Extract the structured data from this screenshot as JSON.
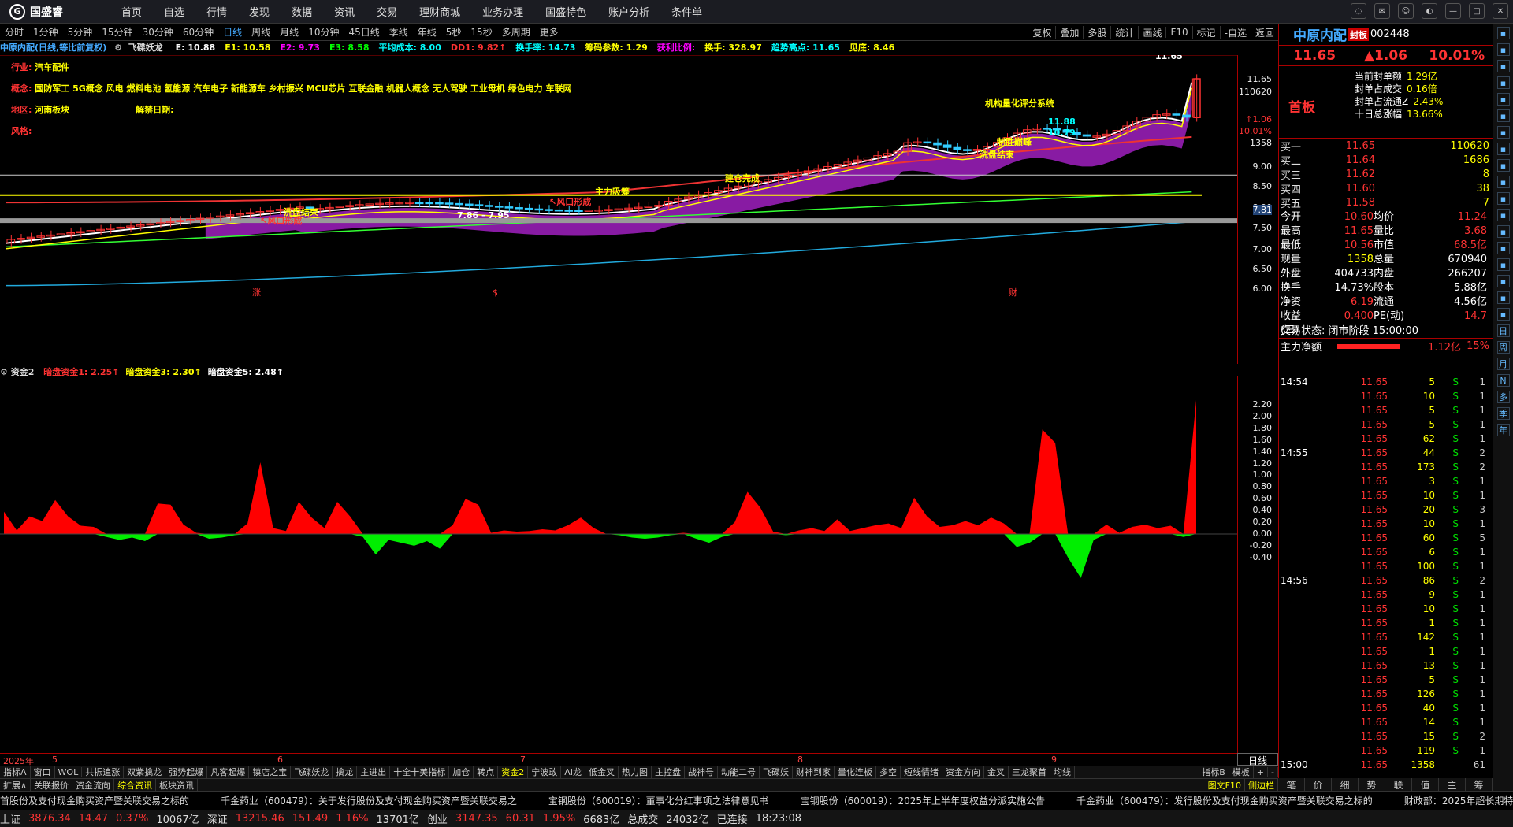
{
  "app": {
    "logo_text": "国盛睿"
  },
  "menu": [
    "首页",
    "自选",
    "行情",
    "发现",
    "数据",
    "资讯",
    "交易",
    "理财商城",
    "业务办理",
    "国盛特色",
    "账户分析",
    "条件单"
  ],
  "periods": [
    "分时",
    "1分钟",
    "5分钟",
    "15分钟",
    "30分钟",
    "60分钟",
    "日线",
    "周线",
    "月线",
    "10分钟",
    "45日线",
    "季线",
    "年线",
    "5秒",
    "15秒",
    "多周期",
    "更多"
  ],
  "period_right": [
    "复权",
    "叠加",
    "多股",
    "统计",
    "画线",
    "F10",
    "标记",
    "-自选",
    "返回"
  ],
  "legend": {
    "title": "中原内配(日线,等比前复权)",
    "indicator": "飞碟妖龙",
    "items": [
      {
        "text": "E: 10.88",
        "color": "#fff"
      },
      {
        "text": "E1: 10.58",
        "color": "#ff0"
      },
      {
        "text": "E2: 9.73",
        "color": "#f0f"
      },
      {
        "text": "E3: 8.58",
        "color": "#0f0"
      },
      {
        "text": "平均成本: 8.00",
        "color": "#0ff"
      },
      {
        "text": "DD1: 9.82↑",
        "color": "#f33"
      },
      {
        "text": "换手率: 14.73",
        "color": "#0ff"
      },
      {
        "text": "筹码参数: 1.29",
        "color": "#ff0"
      },
      {
        "text": "获利比例:",
        "color": "#f0f"
      },
      {
        "text": "换手: 328.97",
        "color": "#ff0"
      },
      {
        "text": "趋势高点: 11.65",
        "color": "#0ff"
      },
      {
        "text": "见底: 8.46",
        "color": "#ff0"
      }
    ]
  },
  "info": {
    "industry_label": "行业:",
    "industry": "汽车配件",
    "concept_label": "概念:",
    "concepts": "国防军工 5G概念 风电 燃料电池 氢能源 汽车电子 新能源车 乡村振兴 MCU芯片 互联金融 机器人概念 无人驾驶 工业母机 绿色电力 车联网",
    "region_label": "地区:",
    "region": "河南板块",
    "unlock_label": "解禁日期:",
    "risk_label": "风格:"
  },
  "chart_annotations": [
    {
      "text": "洗盘结束",
      "color": "#ff0"
    },
    {
      "text": "↖风口形成",
      "color": "#f33"
    },
    {
      "text": "7.86 - 7.95",
      "color": "#fff"
    },
    {
      "text": "主力吸筹",
      "color": "#ff0"
    },
    {
      "text": "↖风口形成",
      "color": "#f33"
    },
    {
      "text": "建仓完成",
      "color": "#ff0"
    },
    {
      "text": "机构量化评分系统",
      "color": "#ff0"
    },
    {
      "text": "11.88",
      "color": "#0ff"
    },
    {
      "text": "10.79",
      "color": "#0ff"
    },
    {
      "text": "制胜巅峰",
      "color": "#ff0"
    },
    {
      "text": "洗盘结束",
      "color": "#ff0"
    },
    {
      "text": "11.65",
      "color": "#fff"
    }
  ],
  "yaxis_main": [
    "11.65",
    "110620",
    "↑1.06",
    "10.01%",
    "1358",
    "9.00",
    "8.50",
    "8.00",
    "7.81",
    "7.50",
    "7.00",
    "6.50",
    "6.00"
  ],
  "markers": [
    "涨",
    "$",
    "财"
  ],
  "subchart": {
    "name": "资金2",
    "items": [
      {
        "text": "暗盘资金1: 2.25↑",
        "color": "#f33"
      },
      {
        "text": "暗盘资金3: 2.30↑",
        "color": "#ff0"
      },
      {
        "text": "暗盘资金5: 2.48↑",
        "color": "#fff"
      }
    ],
    "yaxis": [
      "2.20",
      "2.00",
      "1.80",
      "1.60",
      "1.40",
      "1.20",
      "1.00",
      "0.80",
      "0.60",
      "0.40",
      "0.20",
      "0.00",
      "-0.20",
      "-0.40"
    ]
  },
  "chart_data": {
    "type": "area",
    "series": [
      {
        "name": "资金2",
        "values": [
          0.38,
          0.06,
          0.3,
          0.22,
          0.58,
          0.3,
          0.14,
          0.12,
          -0.05,
          -0.1,
          -0.06,
          -0.12,
          0.52,
          0.5,
          0.16,
          0.02,
          -0.08,
          -0.06,
          -0.02,
          0.18,
          1.22,
          0.1,
          0.05,
          0.55,
          0.28,
          0.1,
          0.55,
          0.3,
          -0.05,
          -0.35,
          -0.1,
          -0.15,
          -0.2,
          -0.12,
          -0.25,
          0.15,
          0.6,
          0.5,
          0.02,
          0.06,
          0.04,
          0.05,
          0.08,
          0.06,
          0.15,
          0.28,
          0.1,
          0.0,
          -0.02,
          -0.06,
          -0.08,
          -0.06,
          -0.02,
          0.02,
          -0.08,
          -0.15,
          -0.05,
          0.2,
          0.72,
          0.45,
          0.04,
          -0.02,
          0.06,
          0.1,
          0.05,
          0.25,
          0.05,
          0.1,
          0.15,
          0.18,
          0.1,
          0.62,
          0.3,
          0.12,
          0.15,
          0.22,
          0.15,
          0.28,
          0.18,
          -0.22,
          -0.15,
          1.78,
          1.55,
          -0.4,
          -0.75,
          -0.1,
          0.16,
          0.02,
          0.12,
          0.16,
          0.1,
          0.14,
          -0.05,
          2.28
        ]
      }
    ],
    "ylim": [
      -0.75,
      2.3
    ]
  },
  "xaxis": [
    "2025年",
    "5",
    "6",
    "7",
    "8",
    "9"
  ],
  "day_label": "日线",
  "tabs1": [
    "指标A",
    "窗口",
    "WOL",
    "共振追涨",
    "双紫擒龙",
    "强势起爆",
    "凡客起爆",
    "镇店之宝",
    "飞碟妖龙",
    "擒龙",
    "主进出",
    "十全十美指标",
    "加仓",
    "转点",
    "资金2",
    "宁波敢",
    "AI龙",
    "低金叉",
    "热力图",
    "主控盘",
    "战神号",
    "动能二号",
    "飞碟妖",
    "财神到家",
    "量化连板",
    "多空",
    "短线情绪",
    "资金方向",
    "金叉",
    "三龙聚首",
    "均线"
  ],
  "tabs1_active": "资金2",
  "tabs1_right": [
    "指标B",
    "模板",
    "+",
    "-"
  ],
  "tabs2": [
    "扩展∧",
    "关联报价",
    "资金流向",
    "综合资讯",
    "板块资讯"
  ],
  "tabs2_right": [
    "图文F10",
    "侧边栏"
  ],
  "news": [
    "首股份及支付现金购买资产暨关联交易之标的",
    "千金药业（600479）：关于发行股份及支付现金购买资产暨关联交易之",
    "宝钢股份（600019）：董事化分红事项之法律意见书",
    "宝钢股份（600019）：2025年上半年度权益分派实施公告",
    "千金药业（600479）：发行股份及支付现金购买资产暨关联交易之标的",
    "财政部：2025年超长期特别"
  ],
  "status": [
    {
      "text": "上证",
      "color": "#ddd"
    },
    {
      "text": "3876.34",
      "color": "#f33"
    },
    {
      "text": "14.47",
      "color": "#f33"
    },
    {
      "text": "0.37%",
      "color": "#f33"
    },
    {
      "text": "10067亿",
      "color": "#ddd"
    },
    {
      "text": "深证",
      "color": "#ddd"
    },
    {
      "text": "13215.46",
      "color": "#f33"
    },
    {
      "text": "151.49",
      "color": "#f33"
    },
    {
      "text": "1.16%",
      "color": "#f33"
    },
    {
      "text": "13701亿",
      "color": "#ddd"
    },
    {
      "text": "创业",
      "color": "#ddd"
    },
    {
      "text": "3147.35",
      "color": "#f33"
    },
    {
      "text": "60.31",
      "color": "#f33"
    },
    {
      "text": "1.95%",
      "color": "#f33"
    },
    {
      "text": "6683亿",
      "color": "#ddd"
    },
    {
      "text": "总成交",
      "color": "#ddd"
    },
    {
      "text": "24032亿",
      "color": "#ddd"
    },
    {
      "text": "已连接",
      "color": "#ddd"
    },
    {
      "text": "18:23:08",
      "color": "#ddd"
    }
  ],
  "right": {
    "name": "中原内配",
    "badge": "封板",
    "code": "002448",
    "price": "11.65",
    "change": "▲1.06",
    "pct": "10.01%",
    "tag": "首板",
    "seal": [
      {
        "k": "当前封单额",
        "v": "1.29亿"
      },
      {
        "k": "封单占成交",
        "v": "0.16倍"
      },
      {
        "k": "封单占流通Z",
        "v": "2.43%"
      },
      {
        "k": "十日总涨幅",
        "v": "13.66%"
      }
    ],
    "sells": [
      {
        "l": "买一",
        "p": "11.65",
        "v": "110620"
      },
      {
        "l": "买二",
        "p": "11.64",
        "v": "1686"
      },
      {
        "l": "买三",
        "p": "11.62",
        "v": "8"
      },
      {
        "l": "买四",
        "p": "11.60",
        "v": "38"
      },
      {
        "l": "买五",
        "p": "11.58",
        "v": "7"
      }
    ],
    "stats": [
      [
        "今开",
        "10.60",
        "均价",
        "11.24"
      ],
      [
        "最高",
        "11.65",
        "量比",
        "3.68"
      ],
      [
        "最低",
        "10.56",
        "市值",
        "68.5亿"
      ],
      [
        "现量",
        "1358",
        "总量",
        "670940"
      ],
      [
        "外盘",
        "404733",
        "内盘",
        "266207"
      ],
      [
        "换手",
        "14.73%",
        "股本",
        "5.88亿"
      ],
      [
        "净资",
        "6.19",
        "流通",
        "4.56亿"
      ],
      [
        "收益(三)",
        "0.400",
        "PE(动)",
        "14.7"
      ]
    ],
    "trade_state": "交易状态: 闭市阶段 15:00:00",
    "net_label": "主力净额",
    "net_value": "1.12亿",
    "net_pct": "15%",
    "trades": [
      {
        "t": "14:54",
        "p": "11.65",
        "v": "5",
        "s": "S",
        "c": "1"
      },
      {
        "t": "",
        "p": "11.65",
        "v": "10",
        "s": "S",
        "c": "1"
      },
      {
        "t": "",
        "p": "11.65",
        "v": "5",
        "s": "S",
        "c": "1"
      },
      {
        "t": "",
        "p": "11.65",
        "v": "5",
        "s": "S",
        "c": "1"
      },
      {
        "t": "",
        "p": "11.65",
        "v": "62",
        "s": "S",
        "c": "1"
      },
      {
        "t": "14:55",
        "p": "11.65",
        "v": "44",
        "s": "S",
        "c": "2"
      },
      {
        "t": "",
        "p": "11.65",
        "v": "173",
        "s": "S",
        "c": "2"
      },
      {
        "t": "",
        "p": "11.65",
        "v": "3",
        "s": "S",
        "c": "1"
      },
      {
        "t": "",
        "p": "11.65",
        "v": "10",
        "s": "S",
        "c": "1"
      },
      {
        "t": "",
        "p": "11.65",
        "v": "20",
        "s": "S",
        "c": "3"
      },
      {
        "t": "",
        "p": "11.65",
        "v": "10",
        "s": "S",
        "c": "1"
      },
      {
        "t": "",
        "p": "11.65",
        "v": "60",
        "s": "S",
        "c": "5"
      },
      {
        "t": "",
        "p": "11.65",
        "v": "6",
        "s": "S",
        "c": "1"
      },
      {
        "t": "",
        "p": "11.65",
        "v": "100",
        "s": "S",
        "c": "1"
      },
      {
        "t": "14:56",
        "p": "11.65",
        "v": "86",
        "s": "S",
        "c": "2"
      },
      {
        "t": "",
        "p": "11.65",
        "v": "9",
        "s": "S",
        "c": "1"
      },
      {
        "t": "",
        "p": "11.65",
        "v": "10",
        "s": "S",
        "c": "1"
      },
      {
        "t": "",
        "p": "11.65",
        "v": "1",
        "s": "S",
        "c": "1"
      },
      {
        "t": "",
        "p": "11.65",
        "v": "142",
        "s": "S",
        "c": "1"
      },
      {
        "t": "",
        "p": "11.65",
        "v": "1",
        "s": "S",
        "c": "1"
      },
      {
        "t": "",
        "p": "11.65",
        "v": "13",
        "s": "S",
        "c": "1"
      },
      {
        "t": "",
        "p": "11.65",
        "v": "5",
        "s": "S",
        "c": "1"
      },
      {
        "t": "",
        "p": "11.65",
        "v": "126",
        "s": "S",
        "c": "1"
      },
      {
        "t": "",
        "p": "11.65",
        "v": "40",
        "s": "S",
        "c": "1"
      },
      {
        "t": "",
        "p": "11.65",
        "v": "14",
        "s": "S",
        "c": "1"
      },
      {
        "t": "",
        "p": "11.65",
        "v": "15",
        "s": "S",
        "c": "2"
      },
      {
        "t": "",
        "p": "11.65",
        "v": "119",
        "s": "S",
        "c": "1"
      },
      {
        "t": "15:00",
        "p": "11.65",
        "v": "1358",
        "s": "",
        "c": "61"
      }
    ],
    "tabs": [
      "笔",
      "价",
      "细",
      "势",
      "联",
      "值",
      "主",
      "筹"
    ]
  },
  "sidebar_icons": [
    "日",
    "周",
    "月",
    "N",
    "多",
    "季",
    "年"
  ]
}
